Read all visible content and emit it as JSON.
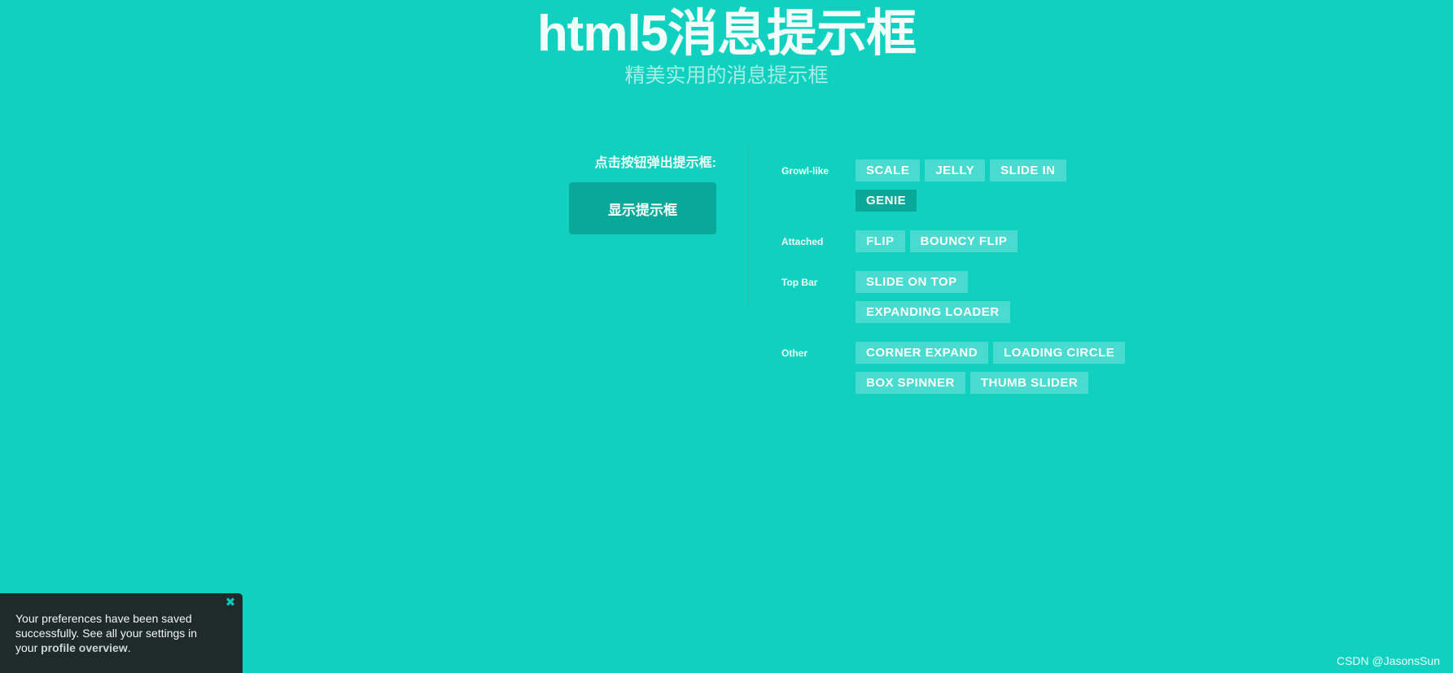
{
  "header": {
    "title": "html5消息提示框",
    "subtitle": "精美实用的消息提示框"
  },
  "left": {
    "prompt": "点击按钮弹出提示框:",
    "show_button": "显示提示框"
  },
  "groups": [
    {
      "label": "Growl-like",
      "buttons": [
        "SCALE",
        "JELLY",
        "SLIDE IN",
        "GENIE"
      ],
      "active": "GENIE"
    },
    {
      "label": "Attached",
      "buttons": [
        "FLIP",
        "BOUNCY FLIP"
      ]
    },
    {
      "label": "Top Bar",
      "buttons": [
        "SLIDE ON TOP",
        "EXPANDING LOADER"
      ]
    },
    {
      "label": "Other",
      "buttons": [
        "CORNER EXPAND",
        "LOADING CIRCLE",
        "BOX SPINNER",
        "THUMB SLIDER"
      ]
    }
  ],
  "toast": {
    "text_before": "Your preferences have been saved successfully. See all your settings in your ",
    "link": "profile overview",
    "text_after": ".",
    "close_icon": "close-icon"
  },
  "watermark": "CSDN @JasonsSun",
  "colors": {
    "background": "#10d0c0",
    "accent_dark": "#0aa898",
    "option_button": "#4adbd0",
    "toast_bg": "#1f2b2b"
  }
}
